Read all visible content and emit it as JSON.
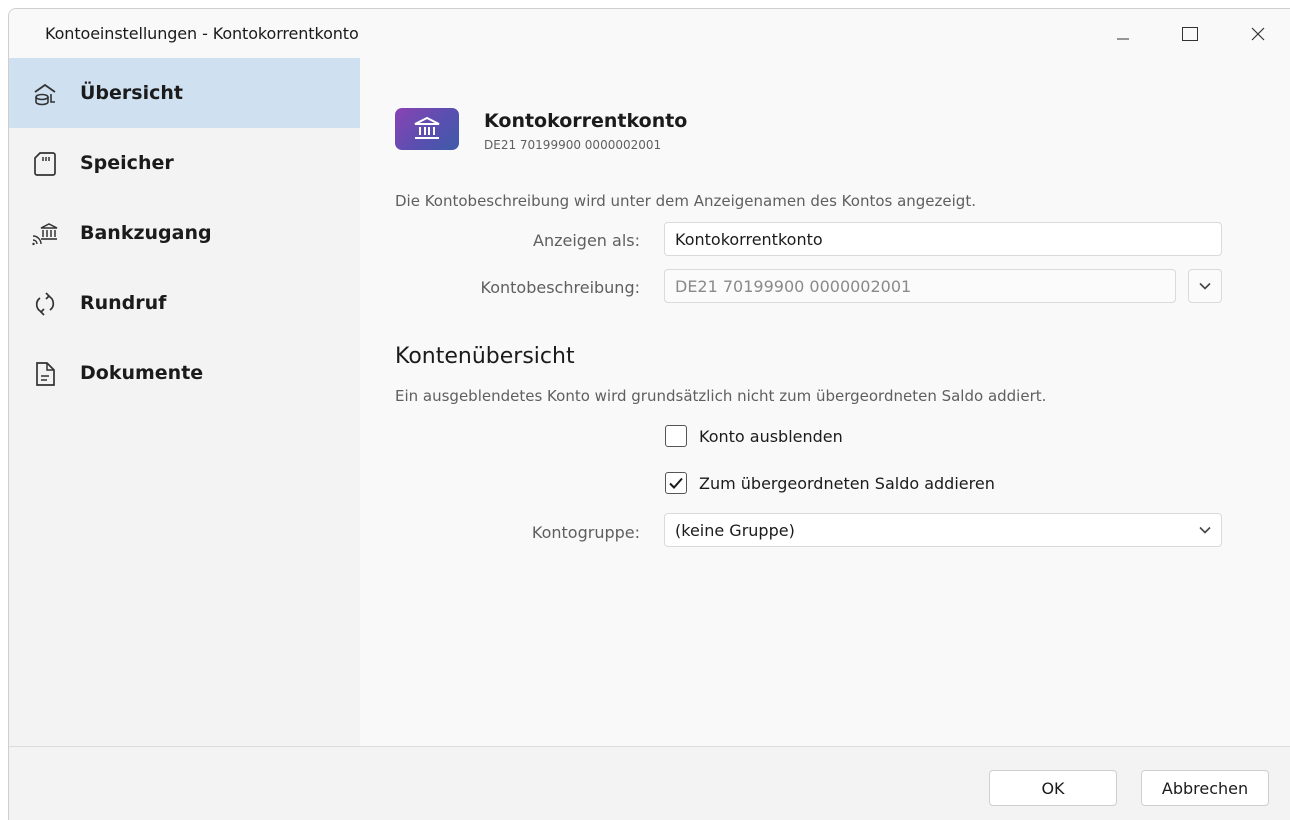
{
  "window": {
    "title": "Kontoeinstellungen - Kontokorrentkonto",
    "controls": [
      "minimize-icon",
      "maximize-icon",
      "close-icon"
    ]
  },
  "sidebar": {
    "items": [
      {
        "label": "Übersicht",
        "icon": "account-overview-icon",
        "active": true
      },
      {
        "label": "Speicher",
        "icon": "sd-card-icon",
        "active": false
      },
      {
        "label": "Bankzugang",
        "icon": "bank-access-icon",
        "active": false
      },
      {
        "label": "Rundruf",
        "icon": "refresh-icon",
        "active": false
      },
      {
        "label": "Dokumente",
        "icon": "document-icon",
        "active": false
      }
    ]
  },
  "account": {
    "name": "Kontokorrentkonto",
    "iban": "DE21 70199900 0000002001",
    "icon": "bank-icon"
  },
  "description_section": {
    "hint": "Die Kontobeschreibung wird unter dem Anzeigenamen des Kontos angezeigt.",
    "display_label": "Anzeigen als:",
    "display_value": "Kontokorrentkonto",
    "description_label": "Kontobeschreibung:",
    "description_value": "DE21 70199900 0000002001"
  },
  "overview_section": {
    "title": "Kontenübersicht",
    "hint": "Ein ausgeblendetes Konto wird grundsätzlich nicht zum übergeordneten Saldo addiert.",
    "hide_label": "Konto ausblenden",
    "hide_checked": false,
    "add_label": "Zum übergeordneten Saldo addieren",
    "add_checked": true,
    "group_label": "Kontogruppe:",
    "group_value": "(keine Gruppe)"
  },
  "footer": {
    "ok_label": "OK",
    "cancel_label": "Abbrechen"
  },
  "colors": {
    "active_nav": "#cfe0f1",
    "icon_gradient_start": "#8a43b3",
    "icon_gradient_end": "#3d5ba8"
  }
}
